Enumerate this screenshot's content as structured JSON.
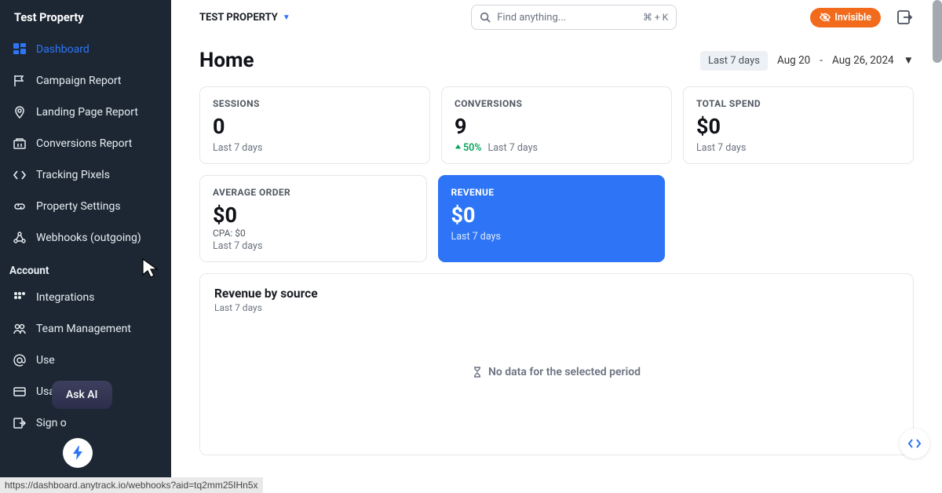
{
  "sidebar": {
    "title": "Test Property",
    "property_items": [
      {
        "icon": "dashboard-icon",
        "label": "Dashboard"
      },
      {
        "icon": "flag-icon",
        "label": "Campaign Report"
      },
      {
        "icon": "pin-icon",
        "label": "Landing Page Report"
      },
      {
        "icon": "conversion-icon",
        "label": "Conversions Report"
      },
      {
        "icon": "code-icon",
        "label": "Tracking Pixels"
      },
      {
        "icon": "link-icon",
        "label": "Property Settings"
      },
      {
        "icon": "webhook-icon",
        "label": "Webhooks (outgoing)"
      }
    ],
    "account_header": "Account",
    "account_items": [
      {
        "icon": "apps-icon",
        "label": "Integrations"
      },
      {
        "icon": "team-icon",
        "label": "Team Management"
      },
      {
        "icon": "at-icon",
        "label": "Use"
      },
      {
        "icon": "card-icon",
        "label": "Usage & billing"
      },
      {
        "icon": "signout-icon",
        "label": "Sign o"
      }
    ]
  },
  "ask_ai": "Ask AI",
  "topbar": {
    "crumb": "TEST PROPERTY",
    "search_placeholder": "Find anything...",
    "search_kbd": "⌘ + K",
    "badge_label": "Invisible"
  },
  "page_title": "Home",
  "date": {
    "chip": "Last 7 days",
    "start": "Aug 20",
    "sep": "-",
    "end": "Aug 26, 2024"
  },
  "cards_row1": [
    {
      "label": "SESSIONS",
      "value": "0",
      "foot": "Last 7 days"
    },
    {
      "label": "CONVERSIONS",
      "value": "9",
      "delta": "50%",
      "foot": "Last 7 days"
    },
    {
      "label": "TOTAL SPEND",
      "value": "$0",
      "foot": "Last 7 days"
    }
  ],
  "cards_row2": [
    {
      "label": "AVERAGE ORDER",
      "value": "$0",
      "sub2": "CPA: $0",
      "foot": "Last 7 days"
    },
    {
      "label": "REVENUE",
      "value": "$0",
      "foot": "Last 7 days"
    }
  ],
  "revenue_panel": {
    "title": "Revenue by source",
    "sub": "Last 7 days",
    "empty": "No data for the selected period"
  },
  "status_url": "https://dashboard.anytrack.io/webhooks?aid=tq2mm25IHn5x"
}
